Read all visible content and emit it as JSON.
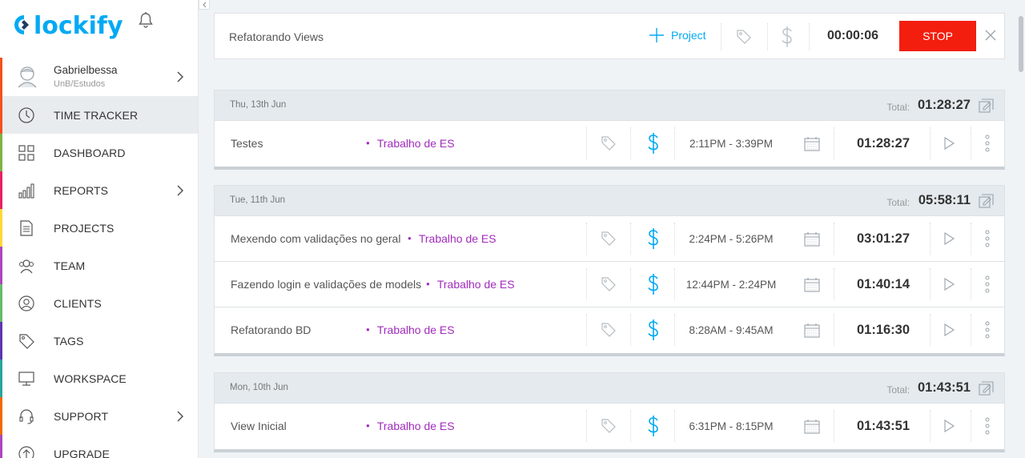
{
  "app": {
    "name": "clockify"
  },
  "user": {
    "name": "Gabrielbessa",
    "workspace": "UnB/Estudos"
  },
  "nav": [
    {
      "label": "TIME TRACKER",
      "icon": "clock-icon",
      "color": "#f4511e",
      "active": true,
      "chevron": false
    },
    {
      "label": "DASHBOARD",
      "icon": "dashboard-icon",
      "color": "#7cb342",
      "active": false,
      "chevron": false
    },
    {
      "label": "REPORTS",
      "icon": "reports-icon",
      "color": "#e91e63",
      "active": false,
      "chevron": true
    },
    {
      "label": "PROJECTS",
      "icon": "projects-icon",
      "color": "#fdd835",
      "active": false,
      "chevron": false
    },
    {
      "label": "TEAM",
      "icon": "team-icon",
      "color": "#ab47bc",
      "active": false,
      "chevron": false
    },
    {
      "label": "CLIENTS",
      "icon": "clients-icon",
      "color": "#66bb6a",
      "active": false,
      "chevron": false
    },
    {
      "label": "TAGS",
      "icon": "tag-icon",
      "color": "#5e35b1",
      "active": false,
      "chevron": false
    },
    {
      "label": "WORKSPACE",
      "icon": "workspace-icon",
      "color": "#26a69a",
      "active": false,
      "chevron": false
    },
    {
      "label": "SUPPORT",
      "icon": "support-icon",
      "color": "#ef6c00",
      "active": false,
      "chevron": true
    },
    {
      "label": "UPGRADE",
      "icon": "upgrade-icon",
      "color": "#ab47bc",
      "active": false,
      "chevron": false
    }
  ],
  "timer": {
    "description": "Refatorando Views",
    "project_label": "Project",
    "elapsed": "00:00:06",
    "stop_label": "STOP"
  },
  "groups": [
    {
      "date": "Thu, 13th Jun",
      "total_label": "Total:",
      "total": "01:28:27",
      "entries": [
        {
          "description": "Testes",
          "project": "Trabalho de ES",
          "range": "2:11PM - 3:39PM",
          "duration": "01:28:27"
        }
      ]
    },
    {
      "date": "Tue, 11th Jun",
      "total_label": "Total:",
      "total": "05:58:11",
      "entries": [
        {
          "description": "Mexendo com validações no geral",
          "project": "Trabalho de ES",
          "range": "2:24PM - 5:26PM",
          "duration": "03:01:27"
        },
        {
          "description": "Fazendo login e validações de models",
          "project": "Trabalho de ES",
          "range": "12:44PM - 2:24PM",
          "duration": "01:40:14"
        },
        {
          "description": "Refatorando BD",
          "project": "Trabalho de ES",
          "range": "8:28AM - 9:45AM",
          "duration": "01:16:30"
        }
      ]
    },
    {
      "date": "Mon, 10th Jun",
      "total_label": "Total:",
      "total": "01:43:51",
      "entries": [
        {
          "description": "View Inicial",
          "project": "Trabalho de ES",
          "range": "6:31PM - 8:15PM",
          "duration": "01:43:51"
        }
      ]
    }
  ],
  "colors": {
    "accent": "#03a9f4",
    "stop": "#f31e0e",
    "project": "#a22bbd"
  }
}
